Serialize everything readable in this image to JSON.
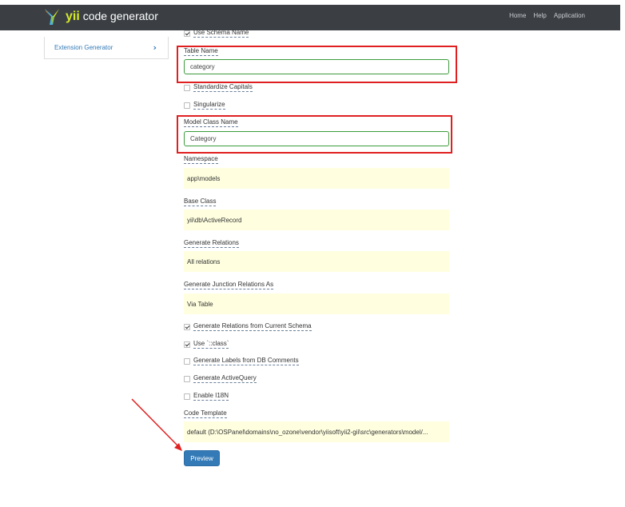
{
  "navbar": {
    "brand_yii": "yii",
    "brand_text": "code generator",
    "links": [
      "Home",
      "Help",
      "Application"
    ]
  },
  "sidebar": {
    "item_label": "Extension Generator",
    "item_chevron": "›"
  },
  "form": {
    "use_schema_name": {
      "label": "Use Schema Name",
      "checked": true
    },
    "table_name": {
      "label": "Table Name",
      "value": "category"
    },
    "standardize_capitals": {
      "label": "Standardize Capitals",
      "checked": false
    },
    "singularize": {
      "label": "Singularize",
      "checked": false
    },
    "model_class_name": {
      "label": "Model Class Name",
      "value": "Category"
    },
    "namespace": {
      "label": "Namespace",
      "value": "app\\models"
    },
    "base_class": {
      "label": "Base Class",
      "value": "yii\\db\\ActiveRecord"
    },
    "generate_relations": {
      "label": "Generate Relations",
      "value": "All relations"
    },
    "generate_junction_relations_as": {
      "label": "Generate Junction Relations As",
      "value": "Via Table"
    },
    "generate_relations_from_current_schema": {
      "label": "Generate Relations from Current Schema",
      "checked": true
    },
    "use_class": {
      "label": "Use `::class`",
      "checked": true
    },
    "generate_labels_from_db_comments": {
      "label": "Generate Labels from DB Comments",
      "checked": false
    },
    "generate_active_query": {
      "label": "Generate ActiveQuery",
      "checked": false
    },
    "enable_i18n": {
      "label": "Enable I18N",
      "checked": false
    },
    "code_template": {
      "label": "Code Template",
      "value": "default (D:\\OSPanel\\domains\\no_ozone\\vendor\\yiisoft\\yii2-gii\\src\\generators\\model/..."
    },
    "preview_button": "Preview"
  },
  "colors": {
    "navbar_bg": "#3b3f44",
    "highlight_box": "#e02020",
    "input_border_valid": "#3c9a3c",
    "readonly_bg": "#ffffe0",
    "primary_button": "#337ab7"
  }
}
